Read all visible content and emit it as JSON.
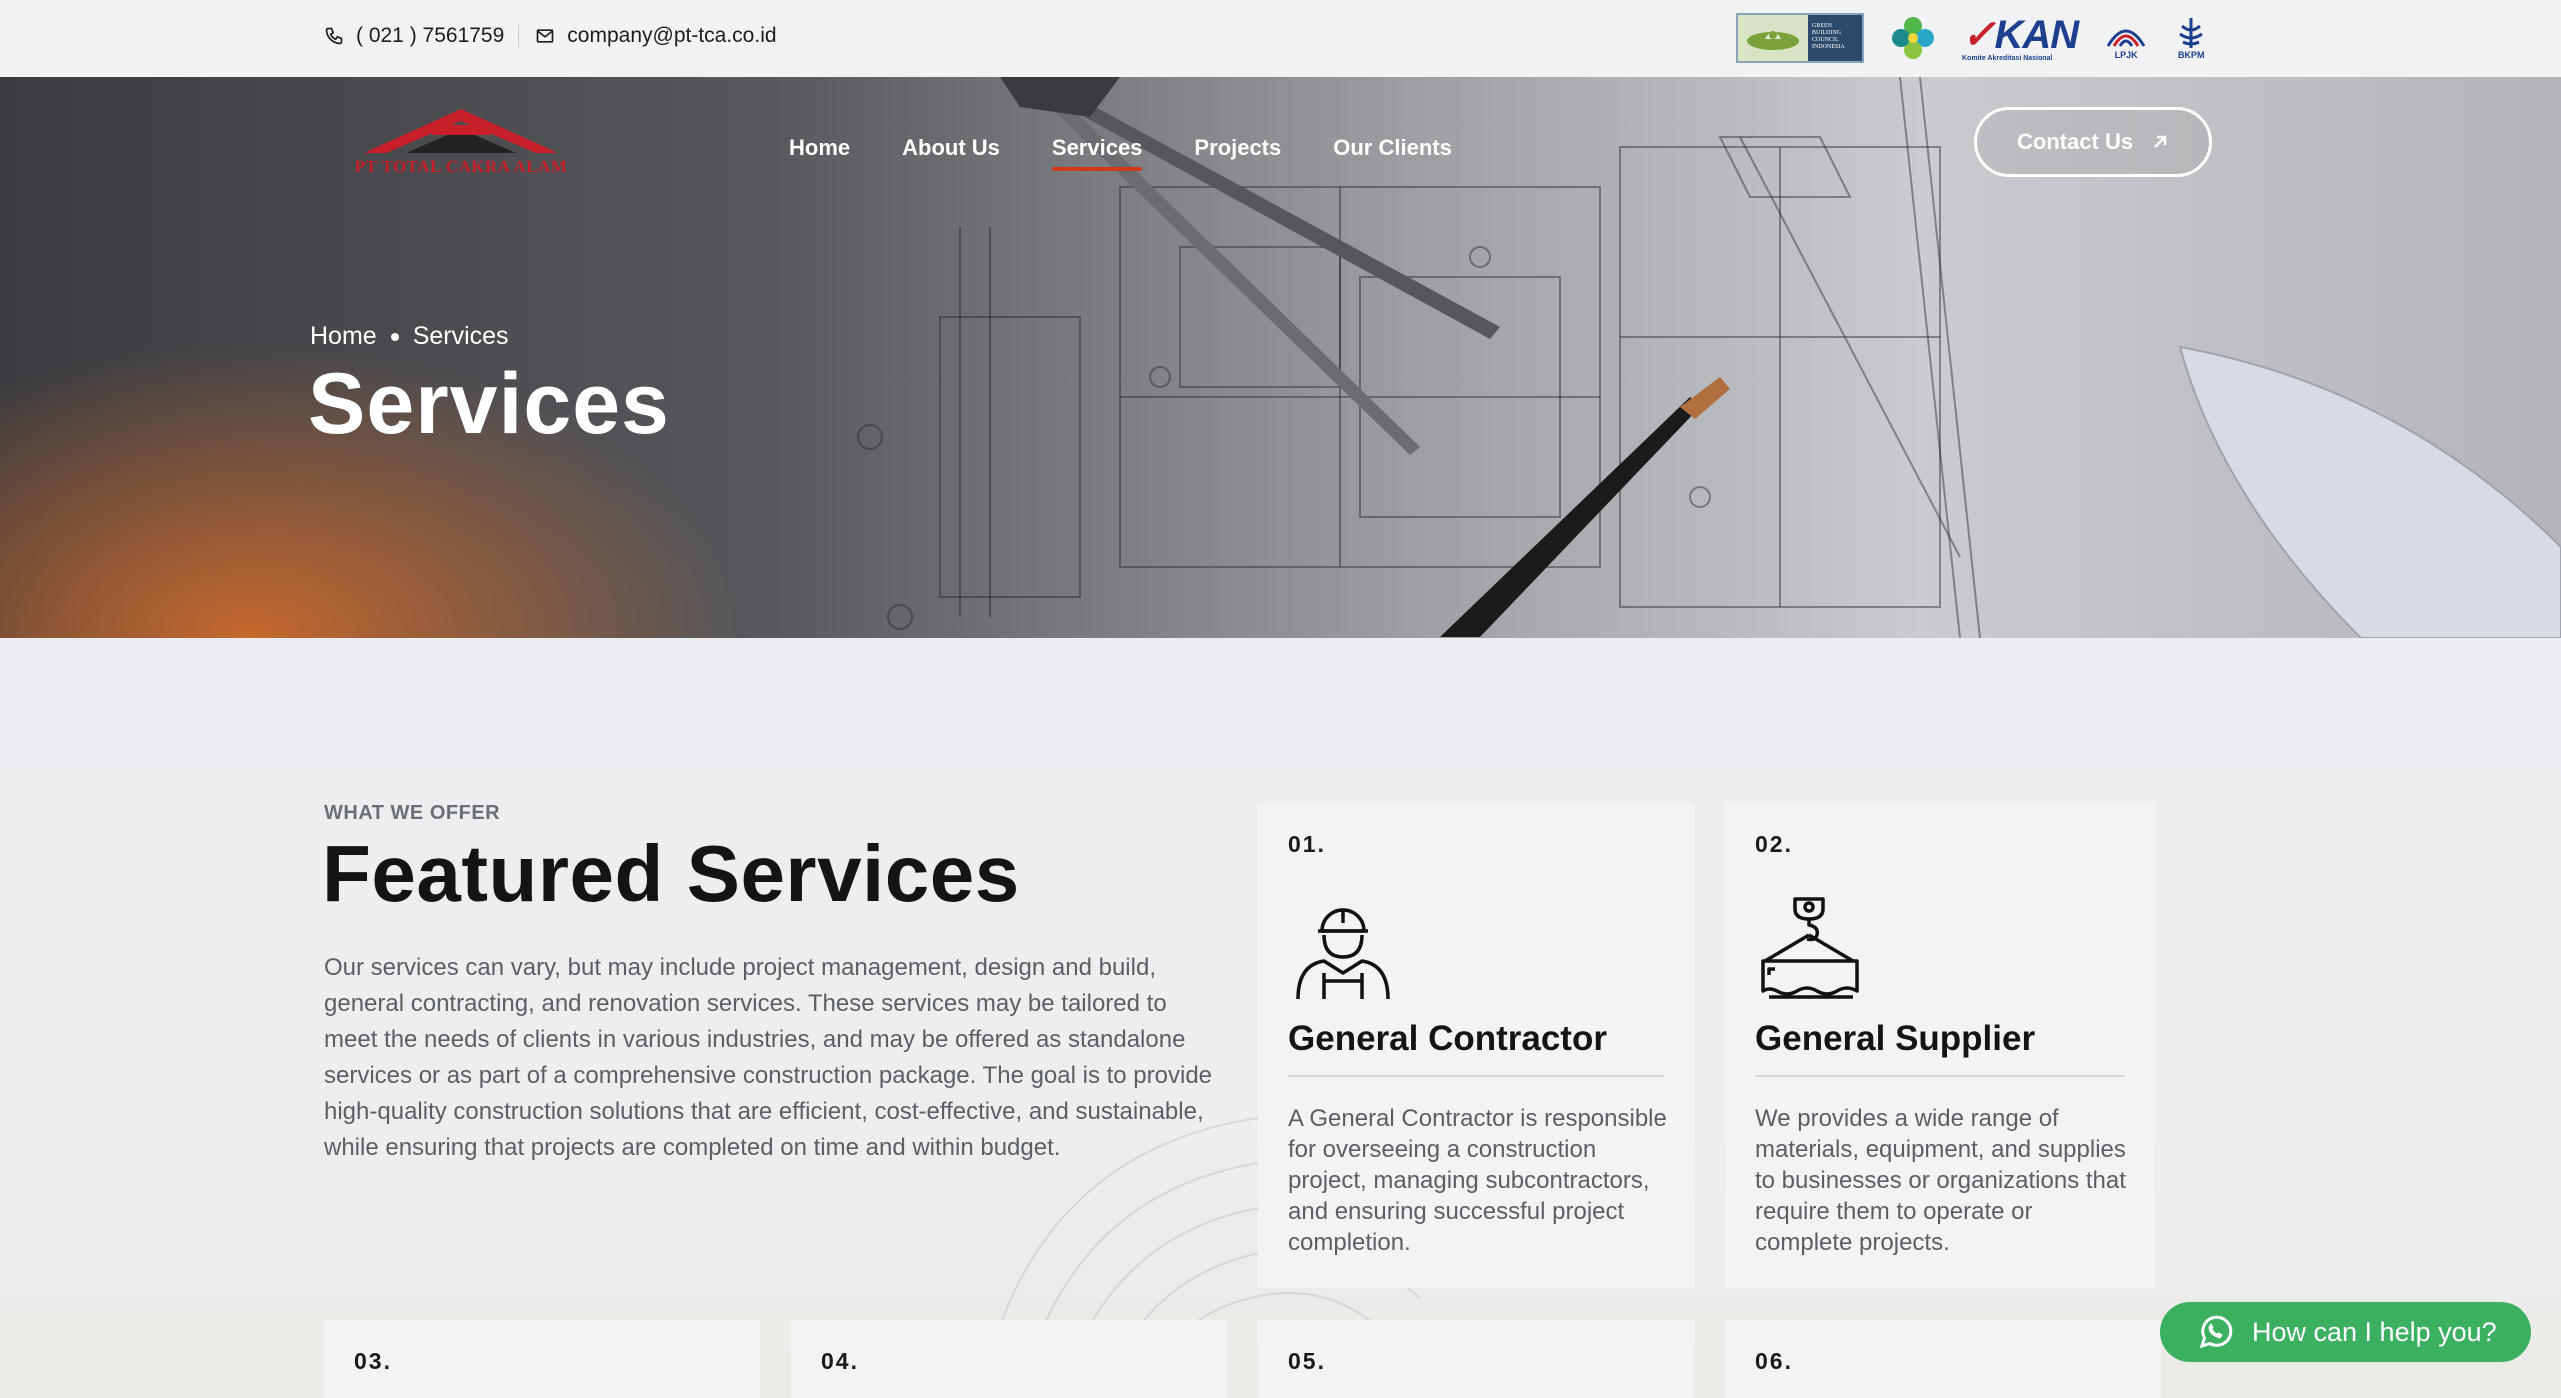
{
  "topbar": {
    "phone": "( 021 ) 7561759",
    "email": "company@pt-tca.co.id",
    "logos": [
      {
        "name": "green-building-council-logo",
        "text": "GREEN BUILDING COUNCIL INDONESIA"
      },
      {
        "name": "flower-logo"
      },
      {
        "name": "kan-logo",
        "main": "KAN",
        "sub": "Komite Akreditasi Nasional"
      },
      {
        "name": "lpjk-logo",
        "text": "LPJK"
      },
      {
        "name": "bkpm-logo",
        "text": "BKPM"
      }
    ]
  },
  "header": {
    "brand": "PT TOTAL CAKRA ALAM",
    "nav": [
      "Home",
      "About Us",
      "Services",
      "Projects",
      "Our Clients"
    ],
    "active_nav": "Services",
    "contact_button": "Contact Us"
  },
  "hero": {
    "breadcrumb": [
      "Home",
      "Services"
    ],
    "title": "Services"
  },
  "featured": {
    "eyebrow": "WHAT WE OFFER",
    "title": "Featured Services",
    "description": "Our services can vary, but may include project management, design and build, general contracting, and renovation services. These services may be tailored to meet the needs of clients in various industries, and may be offered as standalone services or as part of a comprehensive construction package. The goal is to provide high-quality construction solutions that are efficient, cost-effective, and sustainable, while ensuring that projects are completed on time and within budget.",
    "cards": [
      {
        "num": "01.",
        "title": "General Contractor",
        "desc": "A General Contractor is responsible for overseeing a construction project, managing subcontractors, and ensuring successful project completion.",
        "icon": "worker-icon"
      },
      {
        "num": "02.",
        "title": "General Supplier",
        "desc": "We provides a wide range of materials, equipment, and supplies to businesses or organizations that require them to operate or complete projects.",
        "icon": "crane-hook-icon"
      },
      {
        "num": "03."
      },
      {
        "num": "04."
      },
      {
        "num": "05."
      },
      {
        "num": "06."
      }
    ]
  },
  "chat": {
    "label": "How can I help you?",
    "icon": "whatsapp-icon"
  },
  "colors": {
    "accent": "#d23a1c",
    "brand_red": "#c8202a",
    "chat_green": "#3bb061"
  }
}
